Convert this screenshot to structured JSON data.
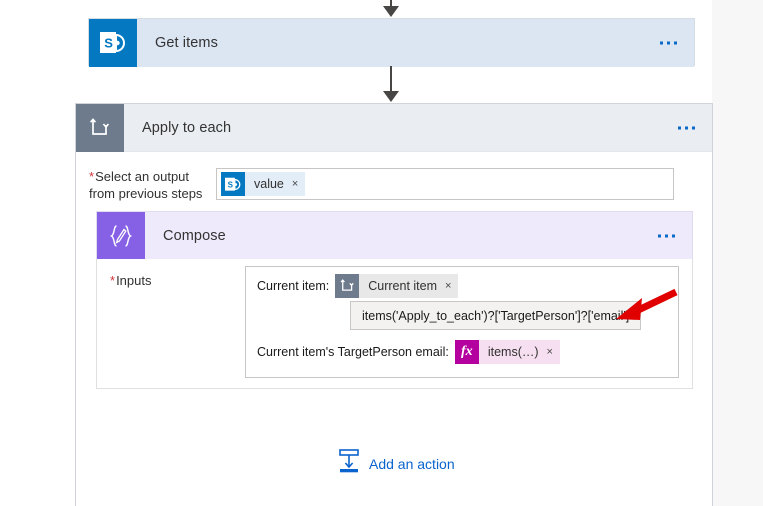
{
  "app": {
    "name": "Power Automate Flow Designer",
    "canvas_background": "#ffffff"
  },
  "colors": {
    "sharepoint_blue": "#0479c1",
    "get_items_header": "#dce6f3",
    "apply_each_header": "#eaedf1",
    "apply_each_icon": "#6d7b8d",
    "compose_header": "#eeeafc",
    "compose_icon": "#8661e5",
    "fx_magenta": "#b4009e",
    "fx_chip_background": "#f5dff0",
    "link_blue": "#0b63ce",
    "required_red": "#d13438",
    "annotation_red": "#e00000",
    "connector_gray": "#484644",
    "tooltip_background": "#f3f2f1"
  },
  "steps": [
    {
      "id": "get-items",
      "title": "Get items",
      "icon": "sharepoint-icon",
      "menu": "more-options"
    },
    {
      "id": "apply-to-each",
      "title": "Apply to each",
      "icon": "loop-icon",
      "menu": "more-options",
      "field": {
        "label_line1": "Select an output",
        "label_line2": "from previous steps",
        "required_marker": "*",
        "token": {
          "text": "value",
          "icon": "sharepoint-icon",
          "remove": "×"
        }
      }
    },
    {
      "id": "compose",
      "title": "Compose",
      "icon": "compose-braces-icon",
      "menu": "more-options",
      "field": {
        "label": "Inputs",
        "required_marker": "*",
        "lines": [
          {
            "prefix": "Current item:",
            "token": {
              "text": "Current item",
              "icon": "loop-icon",
              "remove": "×"
            }
          },
          {
            "prefix": "Current item's TargetPerson email:",
            "token": {
              "text": "items(…)",
              "icon": "fx-icon",
              "remove": "×"
            }
          }
        ]
      }
    }
  ],
  "tooltip": {
    "expression": "items('Apply_to_each')?['TargetPerson']?['email']"
  },
  "annotation": {
    "type": "red-arrow",
    "points_to": "expression-tooltip"
  },
  "add_action": {
    "label": "Add an action",
    "icon": "add-action-icon"
  },
  "connectors": [
    {
      "id": "connector-top",
      "from": "canvas-top",
      "to": "get-items"
    },
    {
      "id": "connector-middle",
      "from": "get-items",
      "to": "apply-to-each"
    }
  ]
}
